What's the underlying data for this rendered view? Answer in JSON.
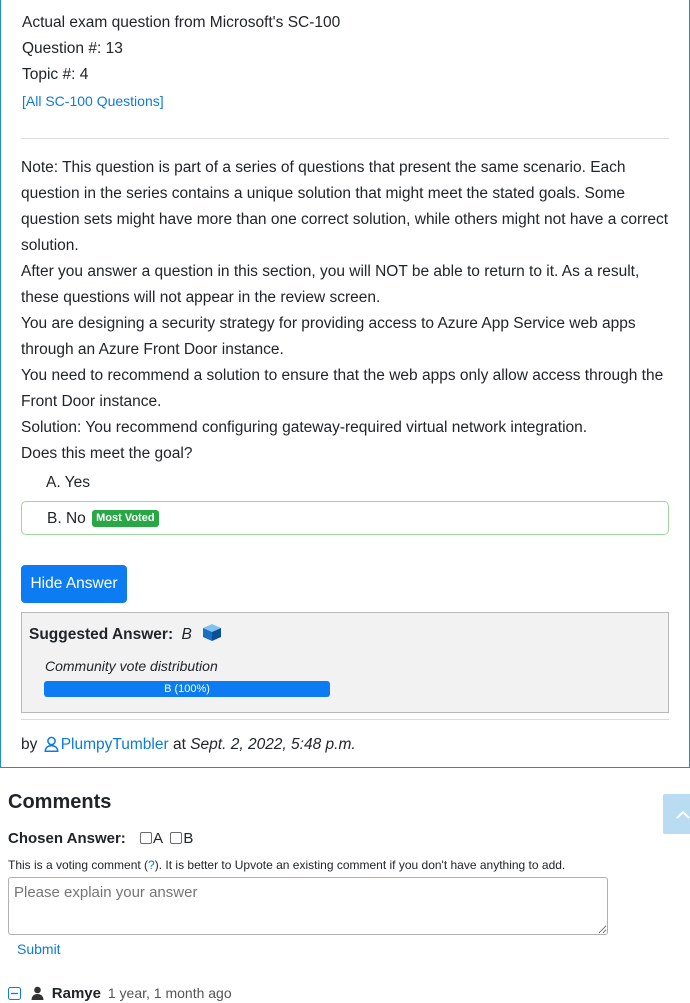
{
  "meta": {
    "source_line": "Actual exam question from Microsoft's SC-100",
    "question_num": "Question #: 13",
    "topic_num": "Topic #: 4",
    "all_questions_link": "[All SC-100 Questions]"
  },
  "question": {
    "paragraphs": [
      "Note: This question is part of a series of questions that present the same scenario. Each question in the series contains a unique solution that might meet the stated goals. Some question sets might have more than one correct solution, while others might not have a correct solution.",
      "After you answer a question in this section, you will NOT be able to return to it. As a result, these questions will not appear in the review screen.",
      "You are designing a security strategy for providing access to Azure App Service web apps through an Azure Front Door instance.",
      "You need to recommend a solution to ensure that the web apps only allow access through the Front Door instance.",
      "Solution: You recommend configuring gateway-required virtual network integration.",
      "Does this meet the goal?"
    ],
    "choices": [
      {
        "label": "A. Yes"
      },
      {
        "label": "B. No",
        "badge": "Most Voted"
      }
    ]
  },
  "hide_answer_button": "Hide Answer",
  "answer": {
    "suggested_label": "Suggested Answer:",
    "suggested_value": "B",
    "community_label": "Community vote distribution",
    "vote_bar_label": "B (100%)",
    "vote_share": 1.0
  },
  "byline": {
    "by": "by",
    "user": "PlumpyTumbler",
    "at": "at",
    "date": "Sept. 2, 2022, 5:48 p.m."
  },
  "comments": {
    "heading": "Comments",
    "chosen_label": "Chosen Answer:",
    "option_a": "A",
    "option_b": "B",
    "note_before": "This is a voting comment (",
    "note_link": "?",
    "note_after": "). It is better to Upvote an existing comment if you don't have anything to add.",
    "placeholder": "Please explain your answer",
    "submit": "Submit",
    "first_comment": {
      "user": "Ramye",
      "time": "1 year, 1 month ago"
    }
  },
  "colors": {
    "accent": "#0d7cf2",
    "success": "#28a745",
    "link": "#0d7bd8"
  }
}
